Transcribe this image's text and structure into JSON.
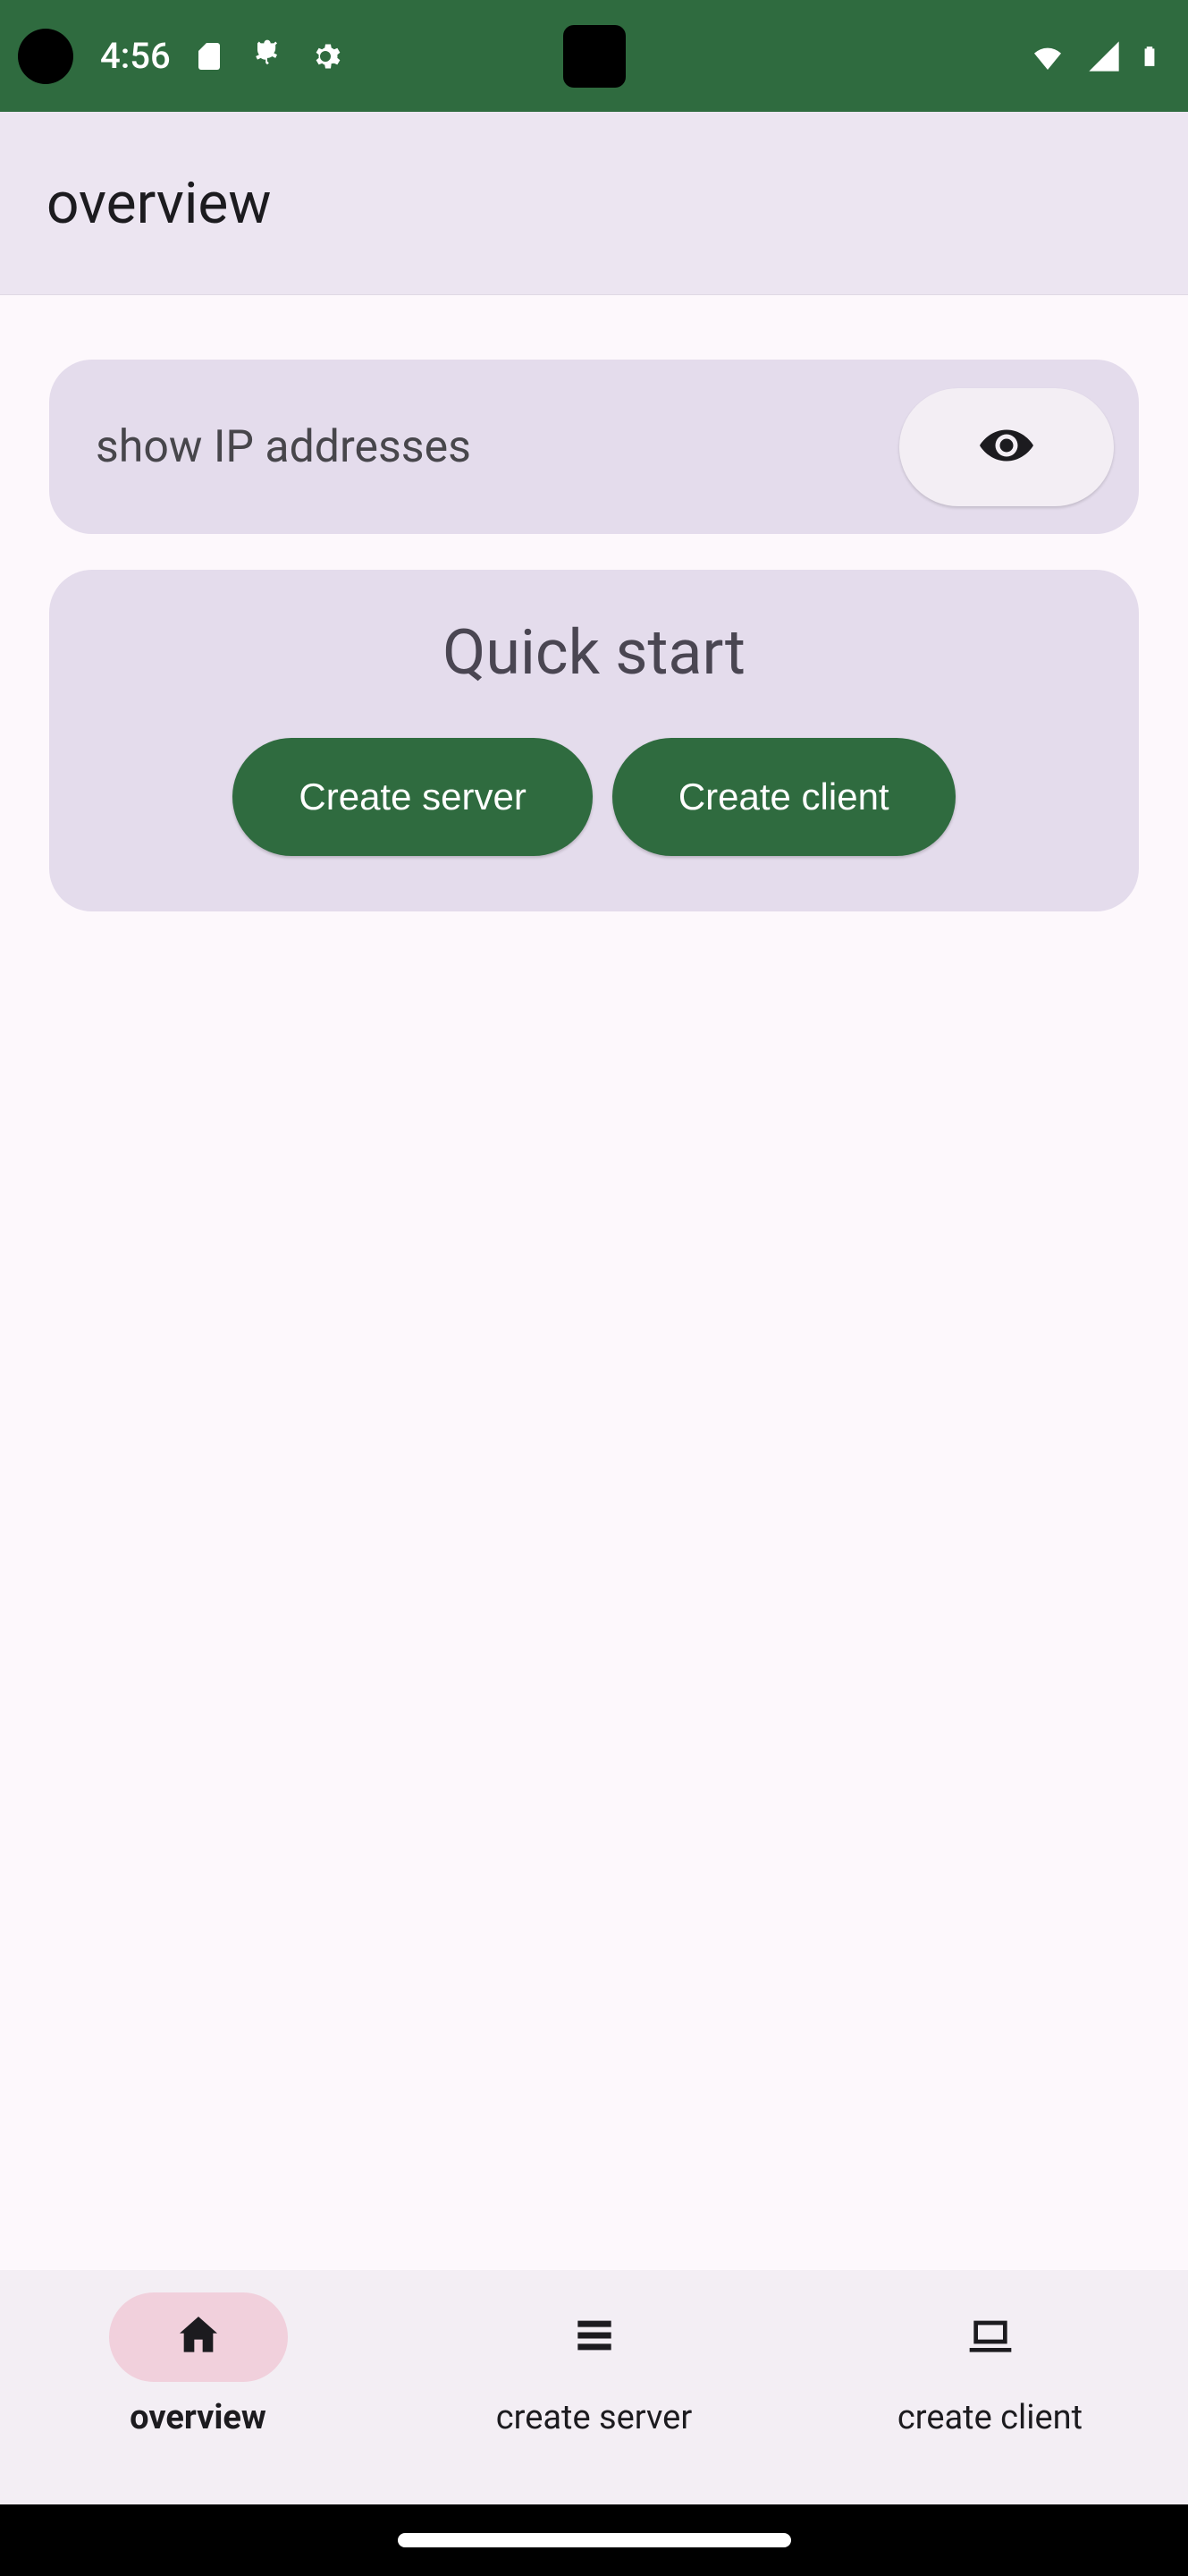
{
  "status_bar": {
    "time": "4:56"
  },
  "app_bar": {
    "title": "overview"
  },
  "ip_card": {
    "label": "show IP addresses"
  },
  "quick_start": {
    "title": "Quick start",
    "create_server_label": "Create server",
    "create_client_label": "Create client"
  },
  "bottom_nav": {
    "items": [
      {
        "label": "overview",
        "selected": true
      },
      {
        "label": "create server",
        "selected": false
      },
      {
        "label": "create client",
        "selected": false
      }
    ]
  }
}
